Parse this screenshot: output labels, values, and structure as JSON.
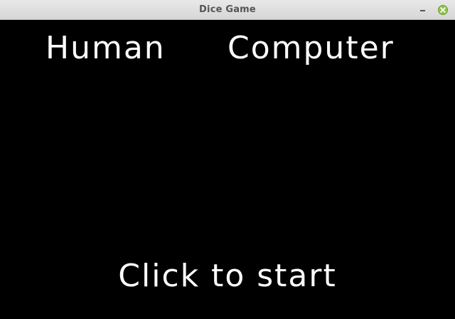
{
  "window": {
    "title": "Dice Game"
  },
  "icons": {
    "minimize": "minimize-icon",
    "close": "close-icon"
  },
  "colors": {
    "background": "#000000",
    "text": "#ffffff",
    "close_button": "#8fc34a"
  },
  "game": {
    "player_label": "Human",
    "opponent_label": "Computer",
    "start_prompt": "Click to start"
  }
}
